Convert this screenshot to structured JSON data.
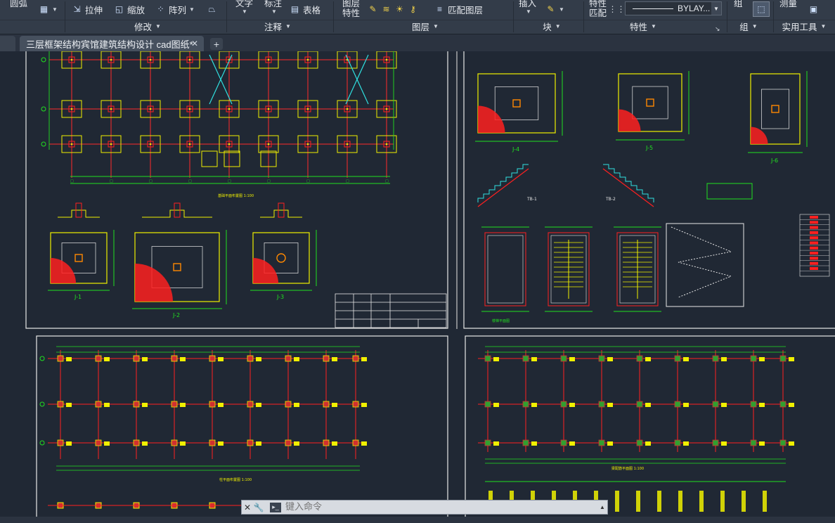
{
  "ribbon": {
    "draw_panel": {
      "label": "圆弧"
    },
    "modify_panel": {
      "stretch_label": "拉伸",
      "scale_label": "缩放",
      "array_label": "阵列",
      "title": "修改"
    },
    "annotation_panel": {
      "text_label": "文字",
      "dim_label": "标注",
      "table_label": "表格",
      "title": "注释"
    },
    "layers_panel": {
      "layer_props_label_1": "图层",
      "layer_props_label_2": "特性",
      "match_layer_label": "匹配图层",
      "title": "图层"
    },
    "block_panel": {
      "insert_label": "插入",
      "title": "块"
    },
    "properties_panel": {
      "match_props_label_1": "特性",
      "match_props_label_2": "匹配",
      "linetype_value": "BYLAY...",
      "title": "特性"
    },
    "group_panel": {
      "group_label": "组",
      "title": "组"
    },
    "utilities_panel": {
      "measure_label": "测量",
      "title": "实用工具"
    }
  },
  "tabs": {
    "document": "三层框架结构宾馆建筑结构设计 cad图纸*"
  },
  "drawing": {
    "sheets": [
      {
        "title": "基础平面布置图 1:100"
      },
      {
        "title": "楼梯平面图"
      },
      {
        "title": "柱平面布置图 1:100"
      },
      {
        "title": "梁配筋平面图 1:100"
      }
    ],
    "details": [
      "J-1",
      "J-2",
      "J-3",
      "J-4",
      "J-5",
      "J-6",
      "TB-1",
      "TB-2"
    ]
  },
  "cmdline": {
    "placeholder": "键入命令"
  },
  "colors": {
    "canvas": "#202834",
    "ribbon": "#333c49",
    "cad_green": "#20e020",
    "cad_yellow": "#f0f000",
    "cad_red": "#ff2020",
    "cad_cyan": "#30e0e0"
  }
}
